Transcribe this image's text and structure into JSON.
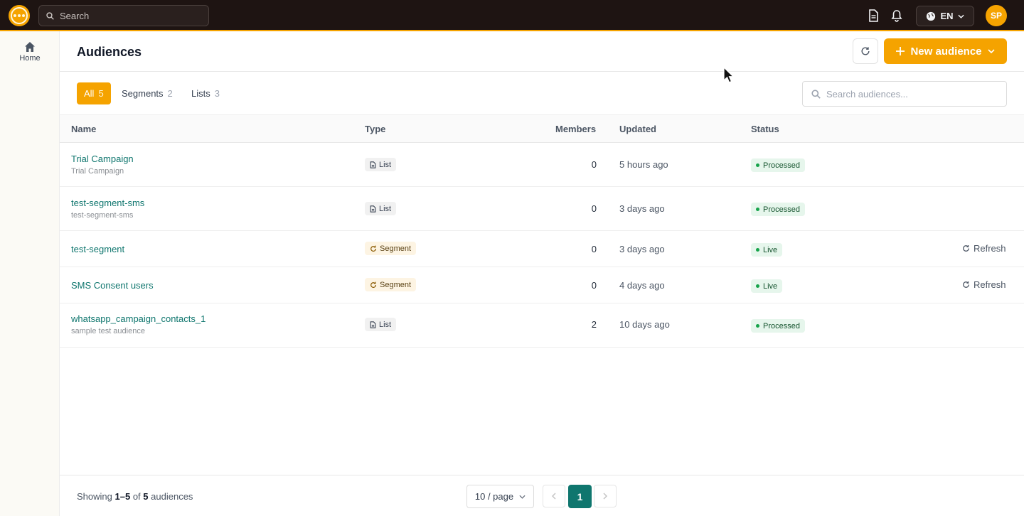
{
  "topbar": {
    "search_placeholder": "Search",
    "language": "EN",
    "avatar_initials": "SP"
  },
  "sidebar": {
    "items": [
      {
        "label": "Home",
        "icon": "home-icon"
      }
    ]
  },
  "header": {
    "title": "Audiences",
    "new_button_label": "New audience"
  },
  "filters": {
    "tabs": [
      {
        "label": "All",
        "count": "5",
        "active": true
      },
      {
        "label": "Segments",
        "count": "2",
        "active": false
      },
      {
        "label": "Lists",
        "count": "3",
        "active": false
      }
    ],
    "search_placeholder": "Search audiences..."
  },
  "table": {
    "columns": {
      "name": "Name",
      "type": "Type",
      "members": "Members",
      "updated": "Updated",
      "status": "Status"
    },
    "rows": [
      {
        "name": "Trial Campaign",
        "description": "Trial Campaign",
        "type": "List",
        "members": "0",
        "updated": "5 hours ago",
        "status": "Processed",
        "action": ""
      },
      {
        "name": "test-segment-sms",
        "description": "test-segment-sms",
        "type": "List",
        "members": "0",
        "updated": "3 days ago",
        "status": "Processed",
        "action": ""
      },
      {
        "name": "test-segment",
        "description": "",
        "type": "Segment",
        "members": "0",
        "updated": "3 days ago",
        "status": "Live",
        "action": "Refresh"
      },
      {
        "name": "SMS Consent users",
        "description": "",
        "type": "Segment",
        "members": "0",
        "updated": "4 days ago",
        "status": "Live",
        "action": "Refresh"
      },
      {
        "name": "whatsapp_campaign_contacts_1",
        "description": "sample test audience",
        "type": "List",
        "members": "2",
        "updated": "10 days ago",
        "status": "Processed",
        "action": ""
      }
    ]
  },
  "footer": {
    "showing_prefix": "Showing",
    "showing_range": "1–5",
    "showing_of": "of",
    "showing_total": "5",
    "showing_suffix": "audiences",
    "page_size": "10 / page",
    "current_page": "1"
  },
  "colors": {
    "brand": "#f5a300",
    "topbar_bg": "#1e1412",
    "link": "#0f766e",
    "status_green": "#16a34a"
  }
}
